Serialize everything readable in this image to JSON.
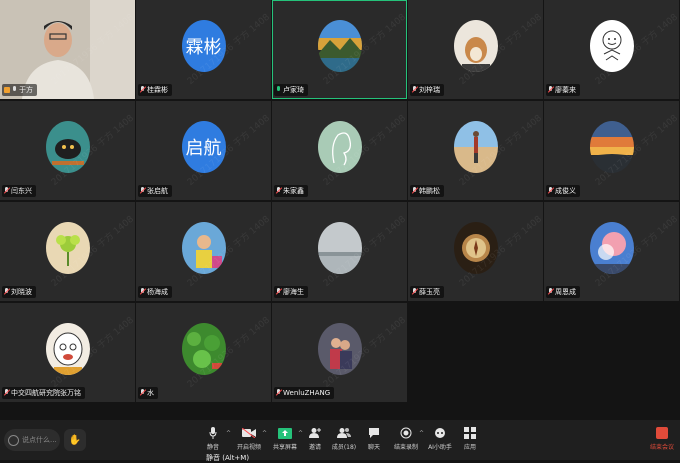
{
  "watermark_text": "2017171936 于方 1408",
  "participants": [
    {
      "name": "于方",
      "kind": "video",
      "mic": "on"
    },
    {
      "name": "桂霖彬",
      "kind": "text",
      "avatar_text": "霖彬",
      "mic": "muted"
    },
    {
      "name": "卢家琦",
      "kind": "photo",
      "scene": "mountain-lake",
      "mic": "speaking",
      "active": true
    },
    {
      "name": "刘梓瑞",
      "kind": "photo",
      "scene": "shiba-dog",
      "mic": "muted"
    },
    {
      "name": "廖蓁来",
      "kind": "photo",
      "scene": "cartoon-face",
      "mic": "muted"
    },
    {
      "name": "闫东兴",
      "kind": "photo",
      "scene": "cartoon-animal",
      "mic": "muted"
    },
    {
      "name": "张启航",
      "kind": "text",
      "avatar_text": "启航",
      "mic": "muted"
    },
    {
      "name": "朱家鑫",
      "kind": "photo",
      "scene": "line-drawing",
      "mic": "muted"
    },
    {
      "name": "韩鹏松",
      "kind": "photo",
      "scene": "desert-person",
      "mic": "muted"
    },
    {
      "name": "成俊义",
      "kind": "photo",
      "scene": "sunset",
      "mic": "muted"
    },
    {
      "name": "刘晓波",
      "kind": "photo",
      "scene": "flower-toy",
      "mic": "muted"
    },
    {
      "name": "杨海成",
      "kind": "photo",
      "scene": "child",
      "mic": "muted"
    },
    {
      "name": "廖海生",
      "kind": "photo",
      "scene": "misty-lake",
      "mic": "muted"
    },
    {
      "name": "薛玉亮",
      "kind": "photo",
      "scene": "compass",
      "mic": "muted"
    },
    {
      "name": "周恩成",
      "kind": "photo",
      "scene": "blue-sky-tree",
      "mic": "muted"
    },
    {
      "name": "中交四航研究院张万铭",
      "kind": "photo",
      "scene": "cartoon-old-man",
      "mic": "muted"
    },
    {
      "name": "水",
      "kind": "photo",
      "scene": "green-plants",
      "mic": "muted"
    },
    {
      "name": "WenluZHANG",
      "kind": "photo",
      "scene": "couple",
      "mic": "muted"
    }
  ],
  "toolbar": {
    "chat_placeholder": "说点什么...",
    "buttons": [
      {
        "label": "静音",
        "icon": "mic-icon"
      },
      {
        "label": "开启视频",
        "icon": "video-icon"
      },
      {
        "label": "共享屏幕",
        "icon": "share-screen-icon"
      },
      {
        "label": "邀请",
        "icon": "invite-icon"
      },
      {
        "label": "成员(18)",
        "icon": "members-icon"
      },
      {
        "label": "聊天",
        "icon": "chat-icon"
      },
      {
        "label": "结束录制",
        "icon": "record-icon"
      },
      {
        "label": "AI小助手",
        "icon": "ai-assistant-icon"
      },
      {
        "label": "应用",
        "icon": "apps-icon"
      }
    ],
    "mute_hint": "静音 (Alt+M)",
    "end_label": "结束会议"
  }
}
